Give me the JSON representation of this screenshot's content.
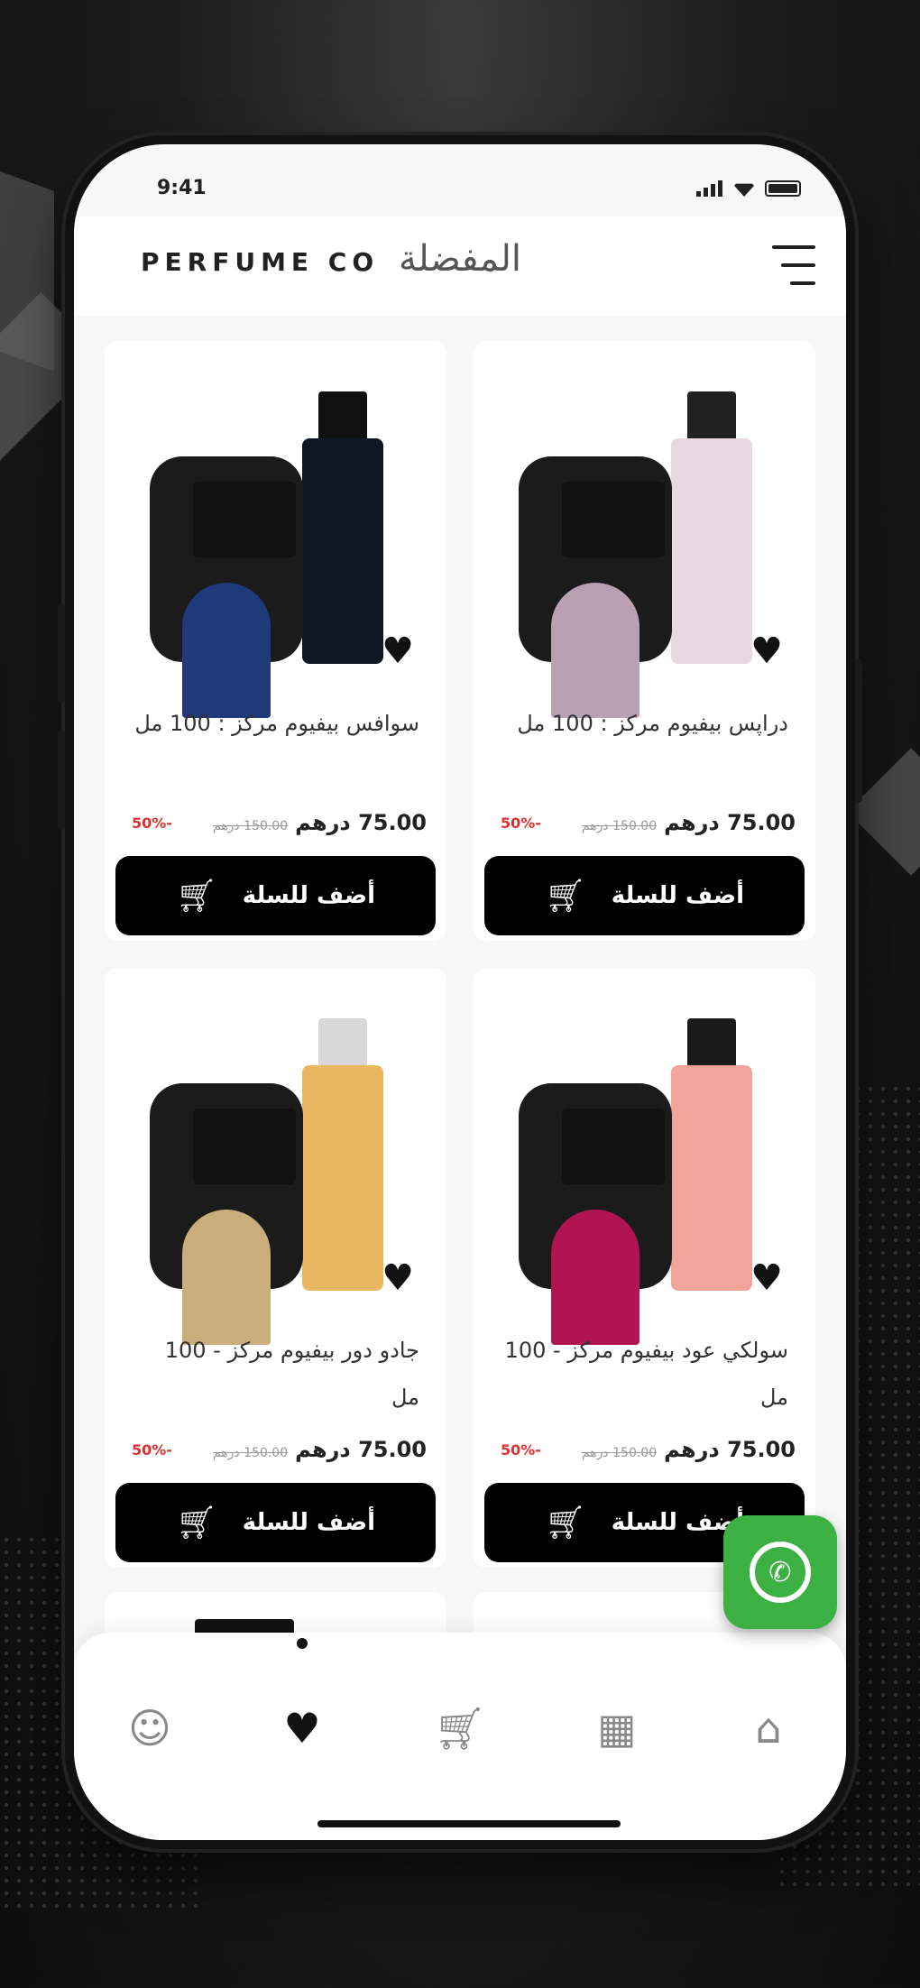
{
  "status": {
    "time": "9:41"
  },
  "header": {
    "brand": "PERFUME CO",
    "title": "المفضلة"
  },
  "products": [
    {
      "name": "دراپس بيفيوم مركز : 100 مل",
      "price": "75.00",
      "currency": "درهم",
      "old_price": "150.00 درهم",
      "discount": "-50%",
      "add_label": "أضف للسلة",
      "label_color": "#b9a0b2",
      "bottle_color": "#e8d8df",
      "bottle_cap_color": "#222222"
    },
    {
      "name": "سوافس بيفيوم مركز : 100 مل",
      "price": "75.00",
      "currency": "درهم",
      "old_price": "150.00 درهم",
      "discount": "-50%",
      "add_label": "أضف للسلة",
      "label_color": "#1f3a78",
      "bottle_color": "#0f1626",
      "bottle_cap_color": "#111111"
    },
    {
      "name": "سولكي عود بيفيوم مركز - 100 مل",
      "price": "75.00",
      "currency": "درهم",
      "old_price": "150.00 درهم",
      "discount": "-50%",
      "add_label": "أضف للسلة",
      "label_color": "#b01552",
      "bottle_color": "#f2a39a",
      "bottle_cap_color": "#1a1a1a"
    },
    {
      "name": "جادو دور بيفيوم مركز - 100 مل",
      "price": "75.00",
      "currency": "درهم",
      "old_price": "150.00 درهم",
      "discount": "-50%",
      "add_label": "أضف للسلة",
      "label_color": "#c9ad7a",
      "bottle_color": "#e8b860",
      "bottle_cap_color": "#d8d8d8"
    }
  ],
  "icons": {
    "menu": "menu-icon",
    "favorite": "heart-icon",
    "cart": "cart-icon",
    "whatsapp": "whatsapp-icon"
  },
  "tabbar": {
    "items": [
      {
        "name": "profile",
        "icon": "user-icon"
      },
      {
        "name": "favorites",
        "icon": "heart-icon",
        "active": true
      },
      {
        "name": "cart",
        "icon": "cart-icon"
      },
      {
        "name": "categories",
        "icon": "grid-icon"
      },
      {
        "name": "home",
        "icon": "home-icon"
      }
    ]
  },
  "colors": {
    "accent": "#000000",
    "discount": "#e03030",
    "whatsapp": "#3cb043"
  }
}
